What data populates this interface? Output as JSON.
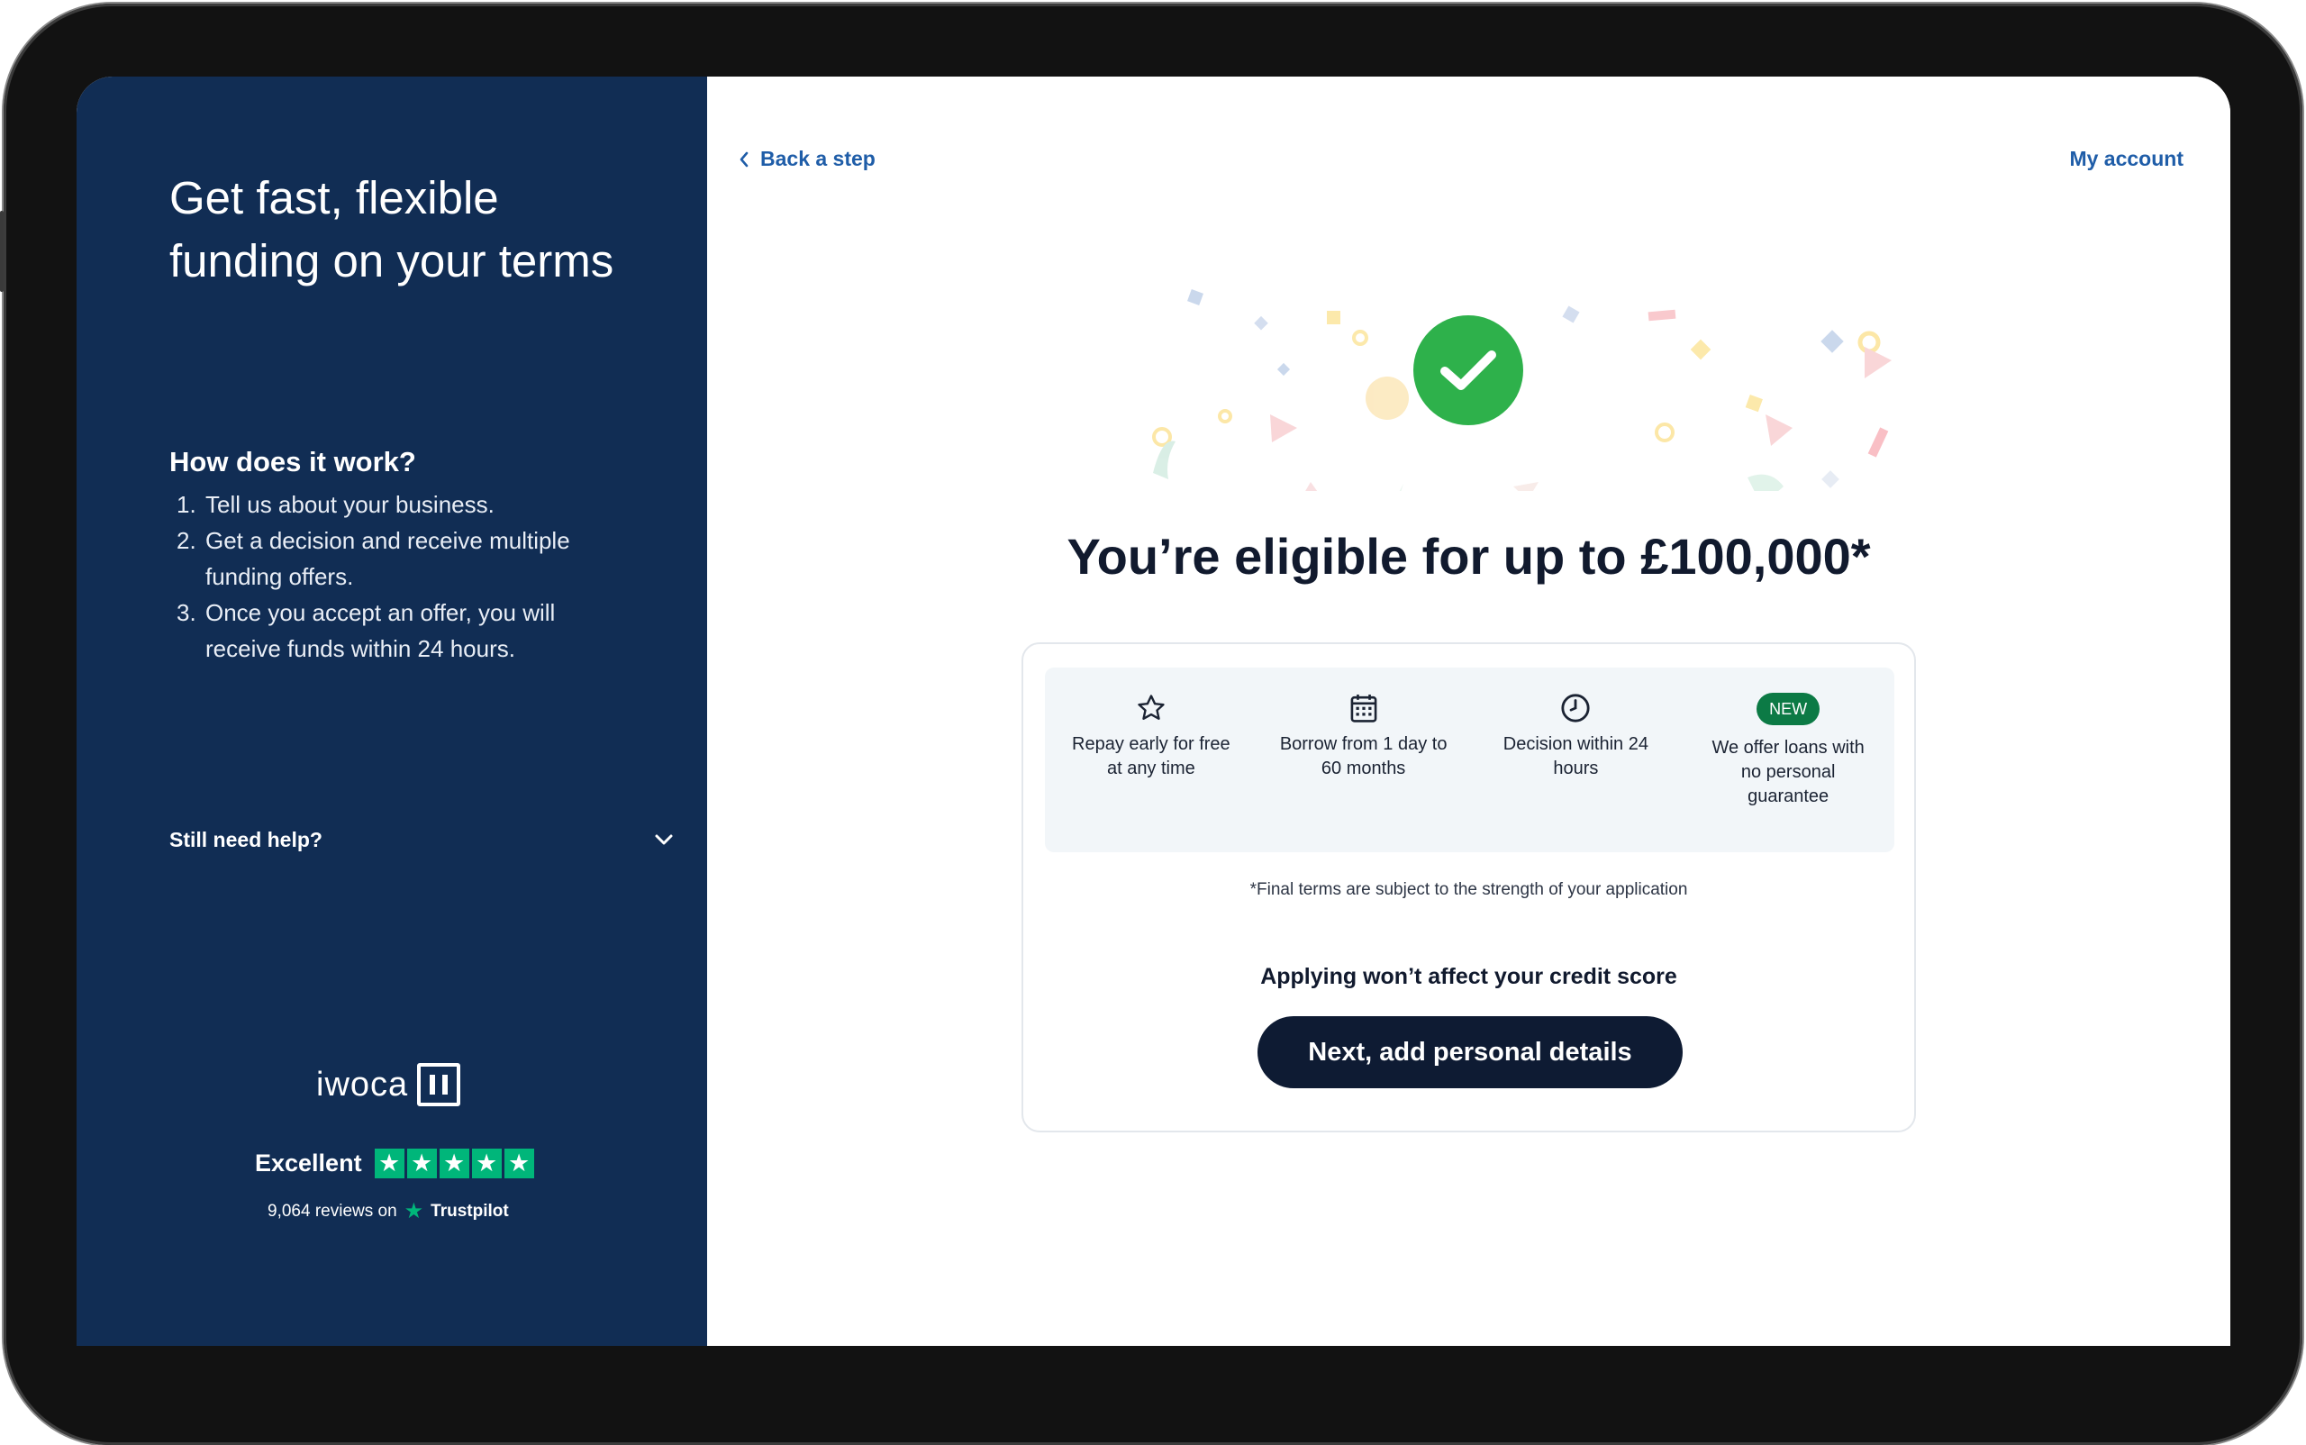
{
  "left_panel": {
    "headline": "Get fast, flexible funding on your terms",
    "how_title": "How does it work?",
    "steps": [
      {
        "num": "1.",
        "text": "Tell us about your business."
      },
      {
        "num": "2.",
        "text": "Get a decision and receive multiple funding offers."
      },
      {
        "num": "3.",
        "text": "Once you accept an offer, you will receive funds within 24 hours."
      }
    ],
    "help_label": "Still need help?",
    "logo_text": "iwoca",
    "trustpilot": {
      "rating_label": "Excellent",
      "stars": 5,
      "reviews_text": "9,064 reviews on",
      "brand": "Trustpilot"
    }
  },
  "right_panel": {
    "back_label": "Back a step",
    "account_label": "My account",
    "eligible_heading": "You’re eligible for up to £100,000*",
    "features": [
      {
        "icon": "star-icon",
        "text": "Repay early for free at any time"
      },
      {
        "icon": "calendar-icon",
        "text": "Borrow from 1 day to 60 months"
      },
      {
        "icon": "clock-icon",
        "text": "Decision within 24 hours"
      },
      {
        "badge": "NEW",
        "text": "We offer loans with no personal guarantee"
      }
    ],
    "footnote": "*Final terms are subject to the strength of your application",
    "credit_note": "Applying won’t affect your credit score",
    "cta_label": "Next, add personal details"
  },
  "colors": {
    "left_bg": "#112d54",
    "link": "#1f5da8",
    "success": "#2eb14b",
    "cta_bg": "#0e1b33",
    "trustpilot_green": "#00b67a",
    "badge_green": "#0c7a45"
  }
}
